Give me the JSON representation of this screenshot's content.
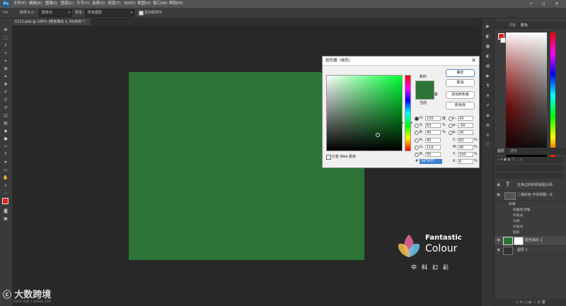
{
  "menu": {
    "app_logo": "Ps",
    "items": [
      "文件(F)",
      "编辑(E)",
      "图像(I)",
      "图层(L)",
      "文字(Y)",
      "选择(S)",
      "滤镜(T)",
      "3D(D)",
      "视图(V)",
      "窗口(W)",
      "帮助(H)"
    ]
  },
  "options": {
    "sample_size_label": "取样大小：",
    "sample_size_value": "取样点",
    "sample_label": "样本：",
    "sample_value": "所有图层",
    "show_ring_label": "显示取样环"
  },
  "document_tab": {
    "label": "1111.psd @ 100% (颜色填充 1, RGB/8) *"
  },
  "status_text": "100%    文档:1.46M/4.33M",
  "watermark": {
    "title": "Fantastic",
    "subtitle": "Colour",
    "chinese": "中科幻彩",
    "bottom_left": "大数跨境"
  },
  "color_picker": {
    "title": "拾色器（纯色）",
    "new_label": "新的",
    "current_label": "当前",
    "ok": "确定",
    "cancel": "取消",
    "add_swatch": "添加到色板",
    "libraries": "颜色库",
    "web_only": "只有 Web 颜色",
    "hex_label": "#",
    "hex_value": "2d7437",
    "hsb": [
      {
        "label": "H:",
        "value": "130",
        "unit": "度"
      },
      {
        "label": "S:",
        "value": "63",
        "unit": "%"
      },
      {
        "label": "B:",
        "value": "45",
        "unit": "%"
      }
    ],
    "rgb": [
      {
        "label": "R:",
        "value": "45"
      },
      {
        "label": "G:",
        "value": "116"
      },
      {
        "label": "B:",
        "value": "55"
      }
    ],
    "lab": [
      {
        "label": "L:",
        "value": "43"
      },
      {
        "label": "a:",
        "value": "-34"
      },
      {
        "label": "b:",
        "value": "26"
      }
    ],
    "cmyk": [
      {
        "label": "C:",
        "value": "83",
        "unit": "%"
      },
      {
        "label": "M:",
        "value": "45",
        "unit": "%"
      },
      {
        "label": "Y:",
        "value": "100",
        "unit": "%"
      },
      {
        "label": "K:",
        "value": "6",
        "unit": "%"
      }
    ],
    "color": "#2d7437"
  },
  "panels": {
    "color_tabs": [
      "调整",
      "颜色"
    ],
    "layers_tabs": [
      "图层",
      "通道"
    ],
    "layers": [
      {
        "name": "在身边的科研绘图大师"
      },
      {
        "name": "二维彩色-字体阴影--大"
      },
      {
        "name": "颜色填充 1"
      },
      {
        "name": "图层 1"
      }
    ],
    "effects": {
      "label": "效果",
      "items": [
        "斜面和浮雕",
        "内发光",
        "光泽",
        "外发光",
        "投影"
      ]
    }
  },
  "colors": {
    "canvas_green": "#2d7437",
    "app_bg": "#282828",
    "fg_color": "#e02020"
  }
}
